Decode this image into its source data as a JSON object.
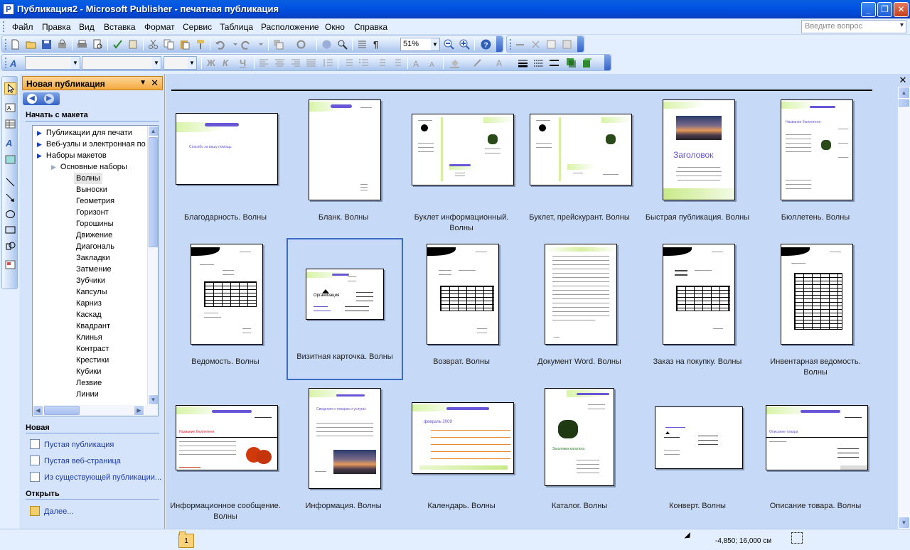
{
  "window": {
    "title": "Публикация2 - Microsoft Publisher - печатная публикация"
  },
  "menu": [
    "Файл",
    "Правка",
    "Вид",
    "Вставка",
    "Формат",
    "Сервис",
    "Таблица",
    "Расположение",
    "Окно",
    "Справка"
  ],
  "question_placeholder": "Введите вопрос",
  "toolbar": {
    "zoom": "51%"
  },
  "taskpane": {
    "title": "Новая публикация",
    "start_section": "Начать с макета",
    "tree": [
      {
        "label": "Публикации для печати",
        "level": 0
      },
      {
        "label": "Веб-узлы и электронная по",
        "level": 0
      },
      {
        "label": "Наборы макетов",
        "level": 0
      },
      {
        "label": "Основные наборы",
        "level": 1
      },
      {
        "label": "Волны",
        "level": 2,
        "selected": true
      },
      {
        "label": "Выноски",
        "level": 2
      },
      {
        "label": "Геометрия",
        "level": 2
      },
      {
        "label": "Горизонт",
        "level": 2
      },
      {
        "label": "Горошины",
        "level": 2
      },
      {
        "label": "Движение",
        "level": 2
      },
      {
        "label": "Диагональ",
        "level": 2
      },
      {
        "label": "Закладки",
        "level": 2
      },
      {
        "label": "Затмение",
        "level": 2
      },
      {
        "label": "Зубчики",
        "level": 2
      },
      {
        "label": "Капсулы",
        "level": 2
      },
      {
        "label": "Карниз",
        "level": 2
      },
      {
        "label": "Каскад",
        "level": 2
      },
      {
        "label": "Квадрант",
        "level": 2
      },
      {
        "label": "Клинья",
        "level": 2
      },
      {
        "label": "Контраст",
        "level": 2
      },
      {
        "label": "Крестики",
        "level": 2
      },
      {
        "label": "Кубики",
        "level": 2
      },
      {
        "label": "Лезвие",
        "level": 2
      },
      {
        "label": "Линии",
        "level": 2
      }
    ],
    "new_section": "Новая",
    "new_links": [
      "Пустая публикация",
      "Пустая веб-страница",
      "Из существующей публикации..."
    ],
    "open_section": "Открыть",
    "open_link": "Далее..."
  },
  "gallery": {
    "tiles": [
      {
        "label": "Благодарность. Волны",
        "kind": "thanks"
      },
      {
        "label": "Бланк. Волны",
        "kind": "letterhead"
      },
      {
        "label": "Буклет информационный. Волны",
        "kind": "brochure"
      },
      {
        "label": "Буклет, прейскурант. Волны",
        "kind": "brochure2"
      },
      {
        "label": "Быстрая публикация. Волны",
        "kind": "quick"
      },
      {
        "label": "Бюллетень. Волны",
        "kind": "newsletter"
      },
      {
        "label": "Ведомость. Волны",
        "kind": "statement"
      },
      {
        "label": "Визитная карточка. Волны",
        "kind": "card",
        "selected": true
      },
      {
        "label": "Возврат. Волны",
        "kind": "refund"
      },
      {
        "label": "Документ Word. Волны",
        "kind": "word"
      },
      {
        "label": "Заказ на покупку. Волны",
        "kind": "order"
      },
      {
        "label": "Инвентарная ведомость. Волны",
        "kind": "inventory"
      },
      {
        "label": "Информационное сообщение. Волны",
        "kind": "flyer"
      },
      {
        "label": "Информация. Волны",
        "kind": "info"
      },
      {
        "label": "Календарь. Волны",
        "kind": "calendar"
      },
      {
        "label": "Каталог. Волны",
        "kind": "catalog"
      },
      {
        "label": "Конверт. Волны",
        "kind": "envelope"
      },
      {
        "label": "Описание товара. Волны",
        "kind": "product"
      }
    ],
    "thumb_text": {
      "thanks": "Спасибо за вашу помощь",
      "quick": "Заголовок",
      "card": "Организация",
      "calendar": "февраль 2009",
      "catalog": "Заголовок каталога",
      "flyer": "Название бюллетеня",
      "product": "Описание товара",
      "info": "Сведения о товарах и услугах",
      "newsletter": "Название бюллетеня"
    }
  },
  "status": {
    "page": "1",
    "coords": "-4,850; 16,000 см"
  }
}
